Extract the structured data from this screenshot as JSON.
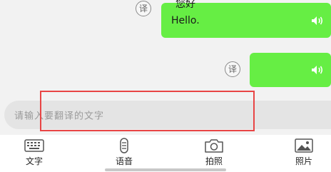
{
  "chat": {
    "translate_glyph": "译",
    "messages": [
      {
        "text": "Hello.",
        "cut_text": "您好"
      },
      {
        "text": ""
      }
    ]
  },
  "input": {
    "placeholder": "请输入要翻译的文字"
  },
  "tabs": [
    {
      "label": "文字",
      "icon": "keyboard-icon"
    },
    {
      "label": "语音",
      "icon": "microphone-icon"
    },
    {
      "label": "拍照",
      "icon": "camera-icon"
    },
    {
      "label": "照片",
      "icon": "image-icon"
    }
  ],
  "colors": {
    "bubble": "#66ee44",
    "highlight": "#e84545"
  }
}
